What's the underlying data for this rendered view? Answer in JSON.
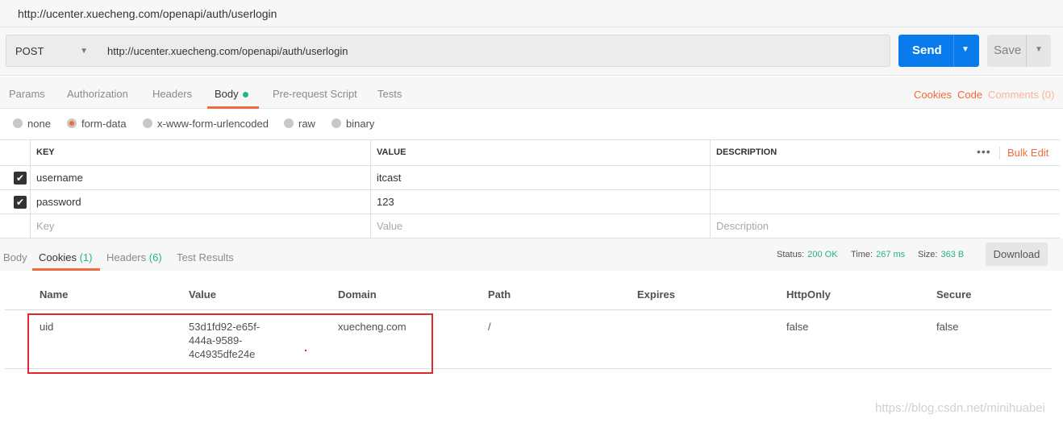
{
  "window": {
    "title": "http://ucenter.xuecheng.com/openapi/auth/userlogin"
  },
  "request": {
    "method": "POST",
    "url": "http://ucenter.xuecheng.com/openapi/auth/userlogin",
    "send_label": "Send",
    "save_label": "Save"
  },
  "request_tabs": {
    "items": [
      "Params",
      "Authorization",
      "Headers",
      "Body",
      "Pre-request Script",
      "Tests"
    ],
    "active": "Body"
  },
  "request_links": {
    "cookies": "Cookies",
    "code": "Code",
    "comments": "Comments (0)"
  },
  "body_types": {
    "options": [
      "none",
      "form-data",
      "x-www-form-urlencoded",
      "raw",
      "binary"
    ],
    "selected": "form-data"
  },
  "params": {
    "headers": {
      "key": "KEY",
      "value": "VALUE",
      "description": "DESCRIPTION"
    },
    "bulk_edit": "Bulk Edit",
    "rows": [
      {
        "key": "username",
        "value": "itcast",
        "description": "",
        "checked": true
      },
      {
        "key": "password",
        "value": "123",
        "description": "",
        "checked": true
      }
    ],
    "placeholders": {
      "key": "Key",
      "value": "Value",
      "description": "Description"
    }
  },
  "response": {
    "tabs": {
      "body": "Body",
      "cookies": "Cookies",
      "cookies_count": "(1)",
      "headers": "Headers",
      "headers_count": "(6)",
      "test_results": "Test Results"
    },
    "status_label": "Status:",
    "status": "200 OK",
    "time_label": "Time:",
    "time": "267 ms",
    "size_label": "Size:",
    "size": "363 B",
    "download_label": "Download"
  },
  "cookies_table": {
    "headers": [
      "Name",
      "Value",
      "Domain",
      "Path",
      "Expires",
      "HttpOnly",
      "Secure"
    ],
    "row": {
      "name": "uid",
      "value_lines": [
        "53d1fd92-e65f-",
        "444a-9589-",
        "4c4935dfe24e"
      ],
      "domain": "xuecheng.com",
      "path": "/",
      "expires": "",
      "httponly": "false",
      "secure": "false"
    }
  },
  "watermark": "https://blog.csdn.net/minihuabei",
  "colors": {
    "accent": "#f26b3a",
    "send": "#097bed",
    "status_green": "#26b47f",
    "highlight_box": "#e0282e"
  }
}
